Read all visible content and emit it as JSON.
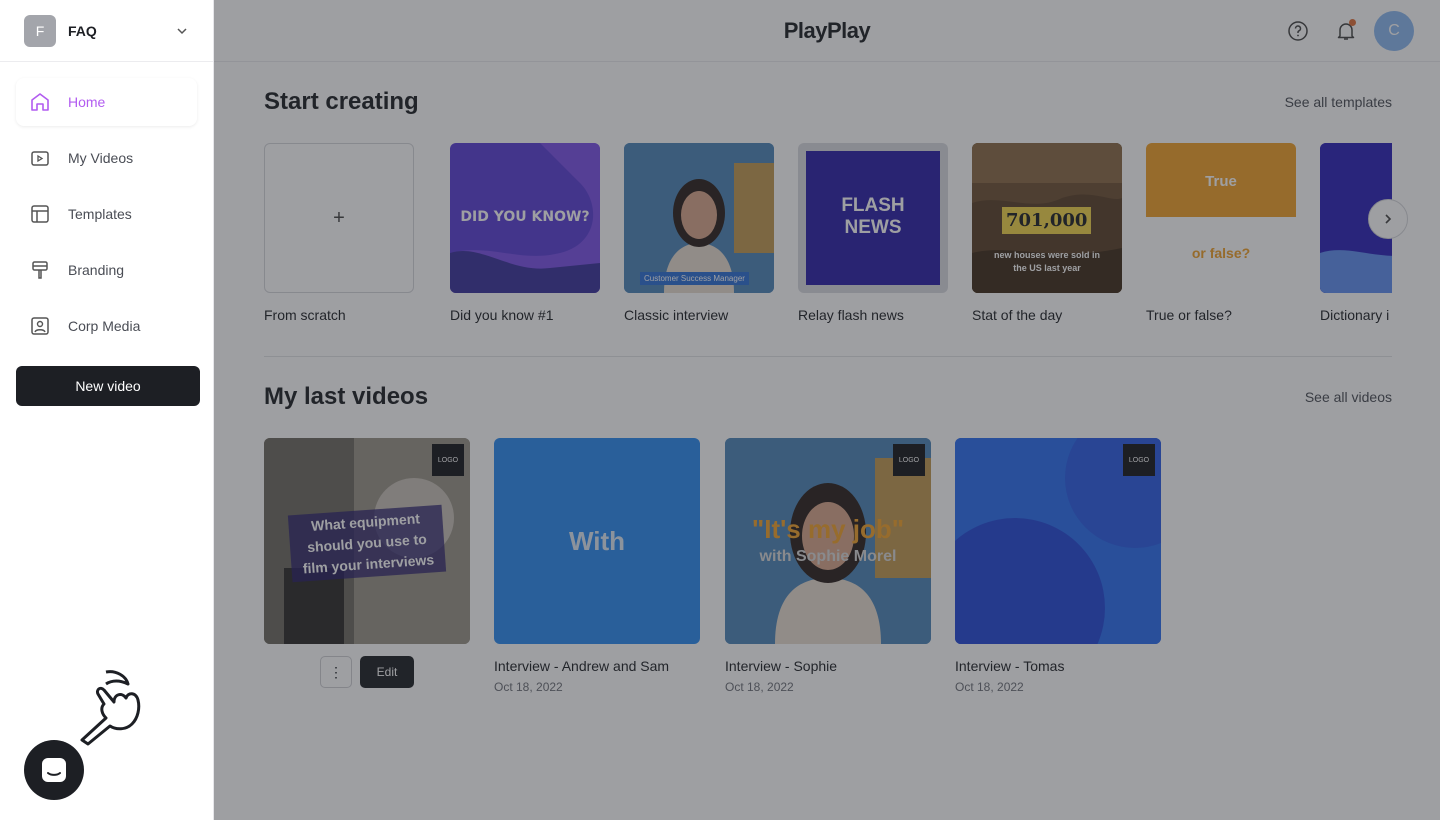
{
  "workspace": {
    "initial": "F",
    "name": "FAQ"
  },
  "nav": {
    "items": [
      {
        "label": "Home",
        "icon": "home-icon",
        "active": true
      },
      {
        "label": "My Videos",
        "icon": "video-icon"
      },
      {
        "label": "Templates",
        "icon": "template-icon"
      },
      {
        "label": "Branding",
        "icon": "brush-icon"
      },
      {
        "label": "Corp Media",
        "icon": "image-icon"
      }
    ],
    "new_video_label": "New video"
  },
  "header": {
    "logo": "PlayPlay",
    "avatar_initial": "C"
  },
  "start_creating": {
    "title": "Start creating",
    "link": "See all templates",
    "templates": [
      {
        "label": "From scratch",
        "thumb_text": "+"
      },
      {
        "label": "Did you know #1",
        "thumb_text": "DID YOU KNOW?"
      },
      {
        "label": "Classic interview",
        "thumb_text": "Customer Success Manager"
      },
      {
        "label": "Relay flash news",
        "thumb_text": "FLASH NEWS"
      },
      {
        "label": "Stat of the day",
        "thumb_big": "701,000",
        "thumb_text": "new houses were sold in the US last year"
      },
      {
        "label": "True or false?",
        "thumb_top": "True",
        "thumb_text": "or false?"
      },
      {
        "label": "Dictionary i"
      }
    ]
  },
  "last_videos": {
    "title": "My last videos",
    "link": "See all videos",
    "videos": [
      {
        "title": "",
        "date": "",
        "thumb_text": "What equipment should you use to film your interviews",
        "logo": "LOGO",
        "more": "⋮",
        "edit": "Edit"
      },
      {
        "title": "Interview - Andrew and Sam",
        "date": "Oct 18, 2022",
        "thumb_text": "With"
      },
      {
        "title": "Interview - Sophie",
        "date": "Oct 18, 2022",
        "thumb_text": "\"It's my job\"",
        "thumb_sub": "with Sophie Morel",
        "logo": "LOGO"
      },
      {
        "title": "Interview - Tomas",
        "date": "Oct 18, 2022",
        "logo": "LOGO"
      }
    ]
  },
  "colors": {
    "accent": "#b25cf0",
    "dark": "#1d1f24",
    "overlay": "rgba(40,42,48,0.45)"
  }
}
